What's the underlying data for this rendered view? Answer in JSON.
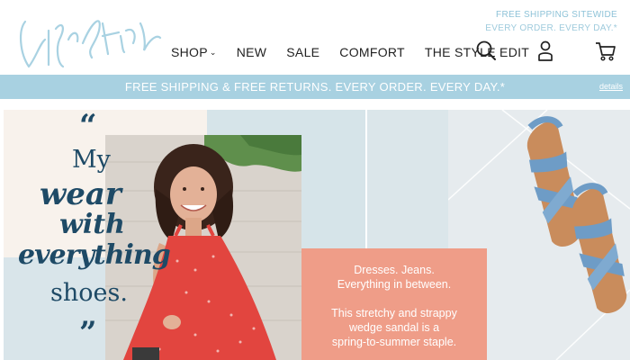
{
  "brand": {
    "logo_text": "Life Stride"
  },
  "header": {
    "promo_line1": "FREE SHIPPING SITEWIDE",
    "promo_line2": "EVERY ORDER. EVERY DAY.*",
    "nav": [
      {
        "label": "SHOP",
        "has_dropdown": true
      },
      {
        "label": "NEW"
      },
      {
        "label": "SALE"
      },
      {
        "label": "COMFORT"
      },
      {
        "label": "THE STYLE EDIT"
      }
    ],
    "icons": [
      "search-icon",
      "account-icon",
      "cart-icon"
    ]
  },
  "banner": {
    "text": "FREE SHIPPING & FREE RETURNS. EVERY ORDER. EVERY DAY.*",
    "link": "details"
  },
  "hero": {
    "open_quote": "“",
    "close_quote": "”",
    "line1": "My",
    "line2": "wear",
    "line3": "with",
    "line4": "everything",
    "line5": "shoes.",
    "box_line1": "Dresses. Jeans.",
    "box_line2": "Everything in between.",
    "box_line3": "This stretchy and strappy",
    "box_line4": "wedge sandal is a",
    "box_line5": "spring-to-summer staple."
  },
  "colors": {
    "accent_blue": "#a8d1e1",
    "navy": "#1e4a66",
    "coral": "#ef9d88",
    "dress_red": "#e2453f"
  }
}
